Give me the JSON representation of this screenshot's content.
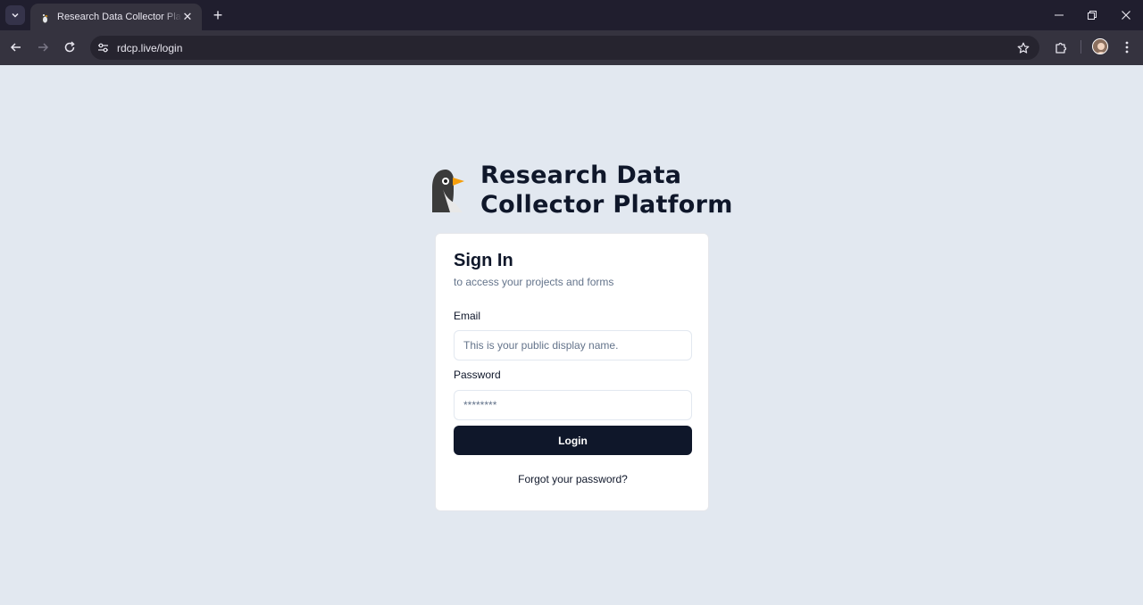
{
  "browser": {
    "tab_title": "Research Data Collector Platform",
    "url": "rdcp.live/login",
    "new_tab_symbol": "+",
    "close_symbol": "✕",
    "tab_list_symbol": "⌄"
  },
  "brand": {
    "title_line1": "Research Data",
    "title_line2": "Collector Platform",
    "logo_icon": "penguin-logo"
  },
  "signin": {
    "title": "Sign In",
    "subtitle": "to access your projects and forms",
    "email_label": "Email",
    "email_placeholder": "This is your public display name.",
    "password_label": "Password",
    "password_placeholder": "********",
    "login_label": "Login",
    "forgot_label": "Forgot your password?"
  },
  "colors": {
    "page_bg": "#e2e8f0",
    "primary": "#0f172a",
    "muted_text": "#64748b",
    "beak": "#f59e0b"
  }
}
